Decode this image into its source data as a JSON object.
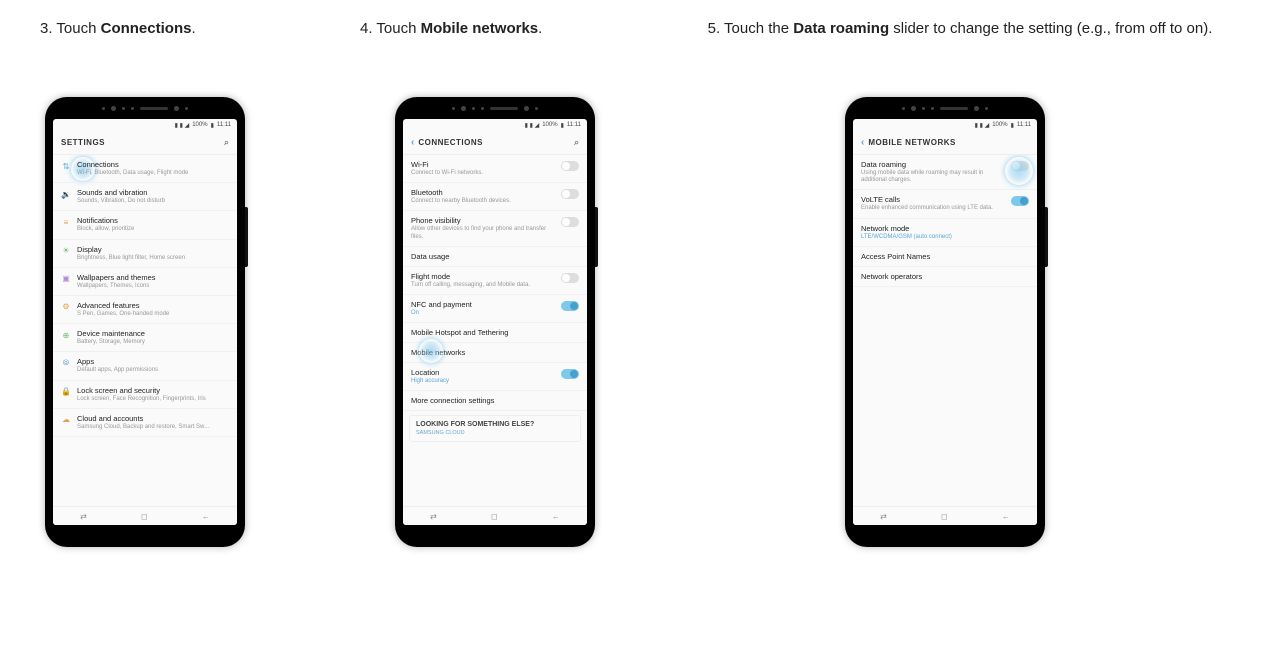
{
  "steps": {
    "s3": {
      "num": "3.",
      "pre": " Touch ",
      "bold": "Connections",
      "post": "."
    },
    "s4": {
      "num": "4.",
      "pre": " Touch ",
      "bold": "Mobile networks",
      "post": "."
    },
    "s5": {
      "num": "5.",
      "pre": " Touch the ",
      "bold": "Data roaming",
      "post": " slider to change the setting (e.g., from off to on)."
    }
  },
  "status": {
    "signal": "▮ ▮ ◢",
    "battery": "100%",
    "time": "11:11",
    "batt_icon": "▮"
  },
  "phone1": {
    "header": "SETTINGS",
    "items": [
      {
        "title": "Connections",
        "sub": "Wi-Fi, Bluetooth, Data usage, Flight mode"
      },
      {
        "title": "Sounds and vibration",
        "sub": "Sounds, Vibration, Do not disturb"
      },
      {
        "title": "Notifications",
        "sub": "Block, allow, prioritize"
      },
      {
        "title": "Display",
        "sub": "Brightness, Blue light filter, Home screen"
      },
      {
        "title": "Wallpapers and themes",
        "sub": "Wallpapers, Themes, Icons"
      },
      {
        "title": "Advanced features",
        "sub": "S Pen, Games, One-handed mode"
      },
      {
        "title": "Device maintenance",
        "sub": "Battery, Storage, Memory"
      },
      {
        "title": "Apps",
        "sub": "Default apps, App permissions"
      },
      {
        "title": "Lock screen and security",
        "sub": "Lock screen, Face Recognition, Fingerprints, Iris"
      },
      {
        "title": "Cloud and accounts",
        "sub": "Samsung Cloud, Backup and restore, Smart Sw..."
      }
    ]
  },
  "phone2": {
    "header": "CONNECTIONS",
    "items": [
      {
        "title": "Wi-Fi",
        "sub": "Connect to Wi-Fi networks.",
        "toggle": "off"
      },
      {
        "title": "Bluetooth",
        "sub": "Connect to nearby Bluetooth devices.",
        "toggle": "off"
      },
      {
        "title": "Phone visibility",
        "sub": "Allow other devices to find your phone and transfer files.",
        "toggle": "off"
      },
      {
        "title": "Data usage"
      },
      {
        "title": "Flight mode",
        "sub": "Turn off calling, messaging, and Mobile data.",
        "toggle": "off"
      },
      {
        "title": "NFC and payment",
        "sub": "On",
        "sub_blue": true,
        "toggle": "on"
      },
      {
        "title": "Mobile Hotspot and Tethering"
      },
      {
        "title": "Mobile networks"
      },
      {
        "title": "Location",
        "sub": "High accuracy",
        "sub_blue": true,
        "toggle": "on"
      },
      {
        "title": "More connection settings"
      }
    ],
    "footer_box": "LOOKING FOR SOMETHING ELSE?",
    "footer_tiny": "SAMSUNG CLOUD"
  },
  "phone3": {
    "header": "MOBILE NETWORKS",
    "items": [
      {
        "title": "Data roaming",
        "sub": "Using mobile data while roaming may result in additional charges.",
        "toggle": "off"
      },
      {
        "title": "VoLTE calls",
        "sub": "Enable enhanced communication using LTE data.",
        "toggle": "on"
      },
      {
        "title": "Network mode",
        "sub": "LTE/WCDMA/GSM (auto connect)",
        "sub_blue": true
      },
      {
        "title": "Access Point Names"
      },
      {
        "title": "Network operators"
      }
    ]
  },
  "softkeys": {
    "recent": "⇄",
    "home": "◻",
    "back": "←"
  }
}
